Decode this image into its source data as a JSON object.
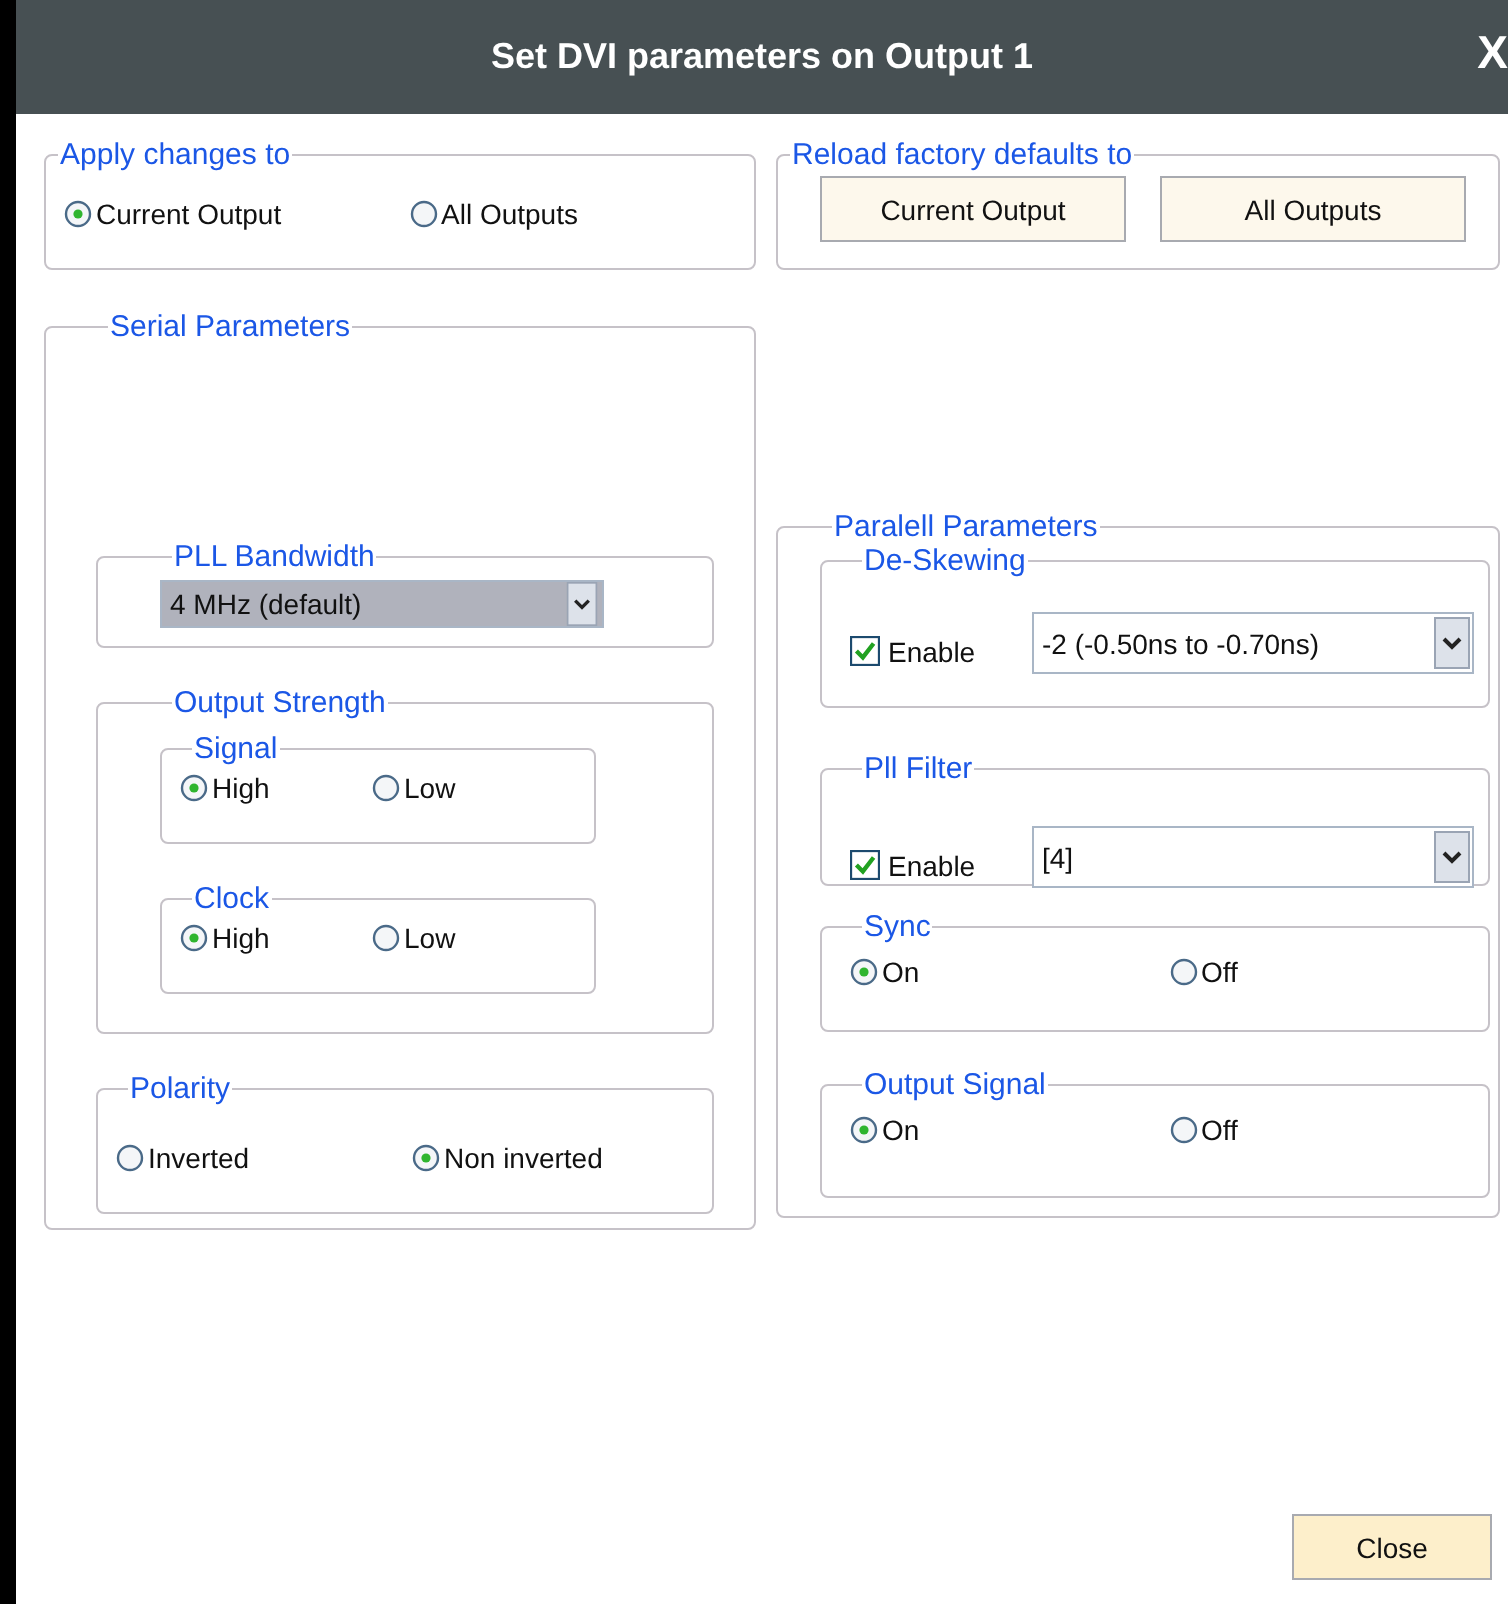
{
  "window": {
    "title": "Set DVI parameters on Output 1",
    "close": "X"
  },
  "apply_changes": {
    "label": "Apply changes to",
    "options": [
      {
        "label": "Current Output",
        "selected": true
      },
      {
        "label": "All Outputs",
        "selected": false
      }
    ]
  },
  "reload_defaults": {
    "label": "Reload factory defaults to",
    "buttons": [
      "Current Output",
      "All Outputs"
    ]
  },
  "serial": {
    "label": "Serial Parameters",
    "pll_bandwidth": {
      "label": "PLL Bandwidth",
      "value": "4 MHz (default)"
    },
    "output_strength": {
      "label": "Output Strength",
      "groups": [
        {
          "label": "Signal",
          "options": [
            {
              "label": "High",
              "selected": true
            },
            {
              "label": "Low",
              "selected": false
            }
          ]
        },
        {
          "label": "Clock",
          "options": [
            {
              "label": "High",
              "selected": true
            },
            {
              "label": "Low",
              "selected": false
            }
          ]
        }
      ]
    },
    "polarity": {
      "label": "Polarity",
      "options": [
        {
          "label": "Inverted",
          "selected": false
        },
        {
          "label": "Non inverted",
          "selected": true
        }
      ]
    }
  },
  "parallel": {
    "label": "Paralell Parameters",
    "deskewing": {
      "label": "De-Skewing",
      "enable": {
        "label": "Enable",
        "checked": true
      },
      "value": "-2 (-0.50ns to -0.70ns)"
    },
    "pll_filter": {
      "label": "Pll Filter",
      "enable": {
        "label": "Enable",
        "checked": true
      },
      "value": "[4]"
    },
    "sync": {
      "label": "Sync",
      "options": [
        {
          "label": "On",
          "selected": true
        },
        {
          "label": "Off",
          "selected": false
        }
      ]
    },
    "output_signal": {
      "label": "Output Signal",
      "options": [
        {
          "label": "On",
          "selected": true
        },
        {
          "label": "Off",
          "selected": false
        }
      ]
    }
  },
  "buttons": [
    "Close"
  ]
}
